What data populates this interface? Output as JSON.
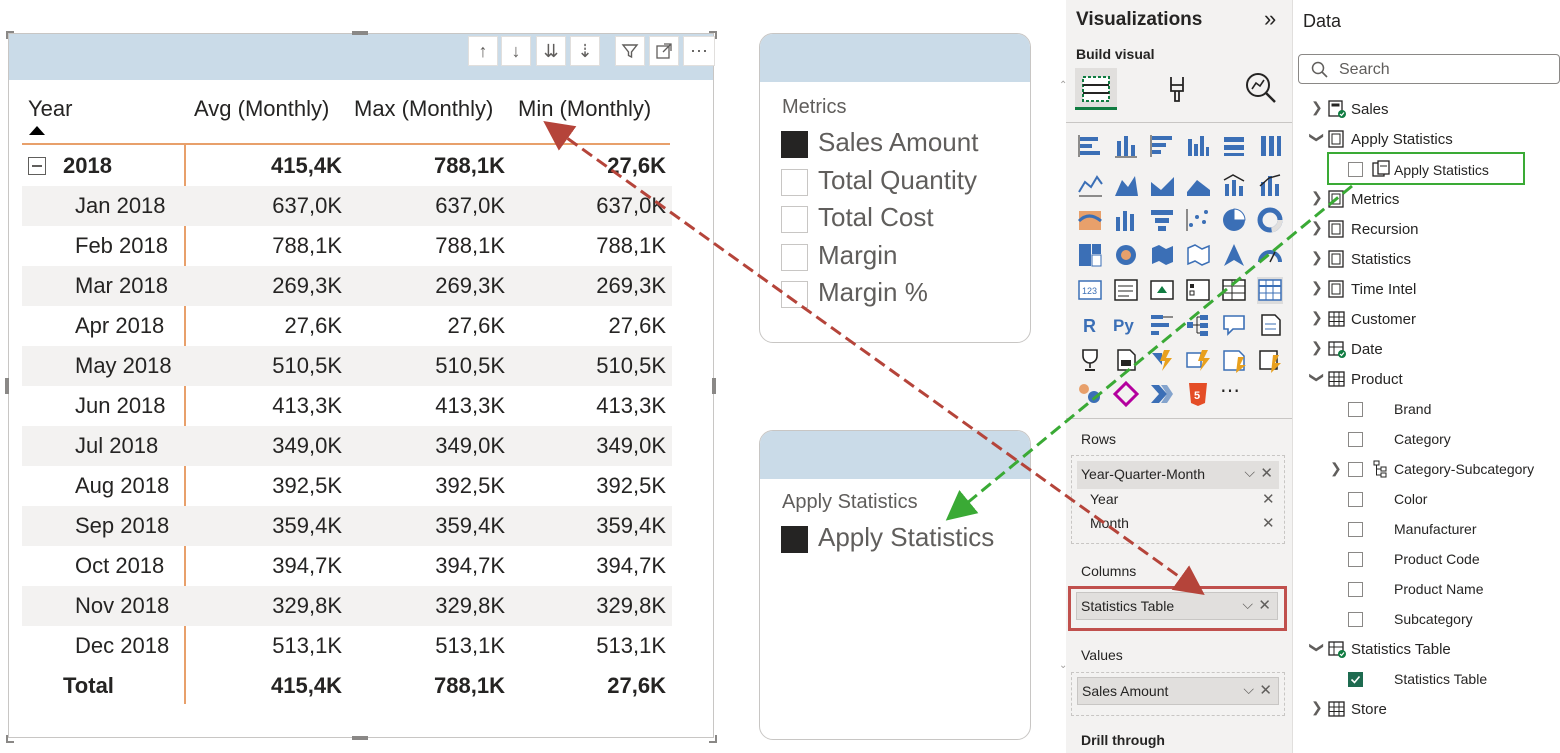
{
  "matrix": {
    "headers": {
      "year": "Year",
      "avg": "Avg (Monthly)",
      "max": "Max (Monthly)",
      "min": "Min (Monthly)"
    },
    "group": {
      "label": "2018",
      "avg": "415,4K",
      "max": "788,1K",
      "min": "27,6K"
    },
    "rows": [
      {
        "label": "Jan 2018",
        "avg": "637,0K",
        "max": "637,0K",
        "min": "637,0K"
      },
      {
        "label": "Feb 2018",
        "avg": "788,1K",
        "max": "788,1K",
        "min": "788,1K"
      },
      {
        "label": "Mar 2018",
        "avg": "269,3K",
        "max": "269,3K",
        "min": "269,3K"
      },
      {
        "label": "Apr 2018",
        "avg": "27,6K",
        "max": "27,6K",
        "min": "27,6K"
      },
      {
        "label": "May 2018",
        "avg": "510,5K",
        "max": "510,5K",
        "min": "510,5K"
      },
      {
        "label": "Jun 2018",
        "avg": "413,3K",
        "max": "413,3K",
        "min": "413,3K"
      },
      {
        "label": "Jul 2018",
        "avg": "349,0K",
        "max": "349,0K",
        "min": "349,0K"
      },
      {
        "label": "Aug 2018",
        "avg": "392,5K",
        "max": "392,5K",
        "min": "392,5K"
      },
      {
        "label": "Sep 2018",
        "avg": "359,4K",
        "max": "359,4K",
        "min": "359,4K"
      },
      {
        "label": "Oct 2018",
        "avg": "394,7K",
        "max": "394,7K",
        "min": "394,7K"
      },
      {
        "label": "Nov 2018",
        "avg": "329,8K",
        "max": "329,8K",
        "min": "329,8K"
      },
      {
        "label": "Dec 2018",
        "avg": "513,1K",
        "max": "513,1K",
        "min": "513,1K"
      }
    ],
    "total": {
      "label": "Total",
      "avg": "415,4K",
      "max": "788,1K",
      "min": "27,6K"
    },
    "toolbar_icons": [
      "drill-up-icon",
      "drill-down-icon",
      "expand-next-level-icon",
      "expand-all-down-icon",
      "filter-icon",
      "focus-mode-icon",
      "more-options-icon"
    ]
  },
  "metrics_slicer": {
    "title": "Metrics",
    "items": [
      {
        "label": "Sales Amount",
        "checked": true
      },
      {
        "label": "Total Quantity",
        "checked": false
      },
      {
        "label": "Total Cost",
        "checked": false
      },
      {
        "label": "Margin",
        "checked": false
      },
      {
        "label": "Margin %",
        "checked": false
      }
    ]
  },
  "stats_slicer": {
    "title": "Apply Statistics",
    "items": [
      {
        "label": "Apply Statistics",
        "checked": true
      }
    ]
  },
  "viz_pane": {
    "title": "Visualizations",
    "collapse_glyph": "»",
    "build_visual": "Build visual",
    "more_glyph": "⋯",
    "rows_label": "Rows",
    "rows_field": "Year-Quarter-Month",
    "rows_subfields": [
      "Year",
      "Month"
    ],
    "columns_label": "Columns",
    "columns_field": "Statistics Table",
    "values_label": "Values",
    "values_field": "Sales Amount",
    "drill_label": "Drill through"
  },
  "data_pane": {
    "title": "Data",
    "search_placeholder": "Search",
    "tables": [
      {
        "name": "Sales"
      },
      {
        "name": "Apply Statistics"
      },
      {
        "name": "Metrics"
      },
      {
        "name": "Recursion"
      },
      {
        "name": "Statistics"
      },
      {
        "name": "Time Intel"
      },
      {
        "name": "Customer"
      },
      {
        "name": "Date"
      },
      {
        "name": "Product"
      },
      {
        "name": "Statistics Table"
      },
      {
        "name": "Store"
      }
    ],
    "apply_statistics_field": "Apply Statistics",
    "product_fields": [
      "Brand",
      "Category",
      "Category-Subcategory",
      "Color",
      "Manufacturer",
      "Product Code",
      "Product Name",
      "Subcategory"
    ],
    "statistics_table_field": "Statistics Table"
  },
  "colors": {
    "accent_orange": "#e8a06b",
    "header_blue": "#cadbe8",
    "arrow_red": "#b5443a",
    "arrow_green": "#3aaa35"
  }
}
